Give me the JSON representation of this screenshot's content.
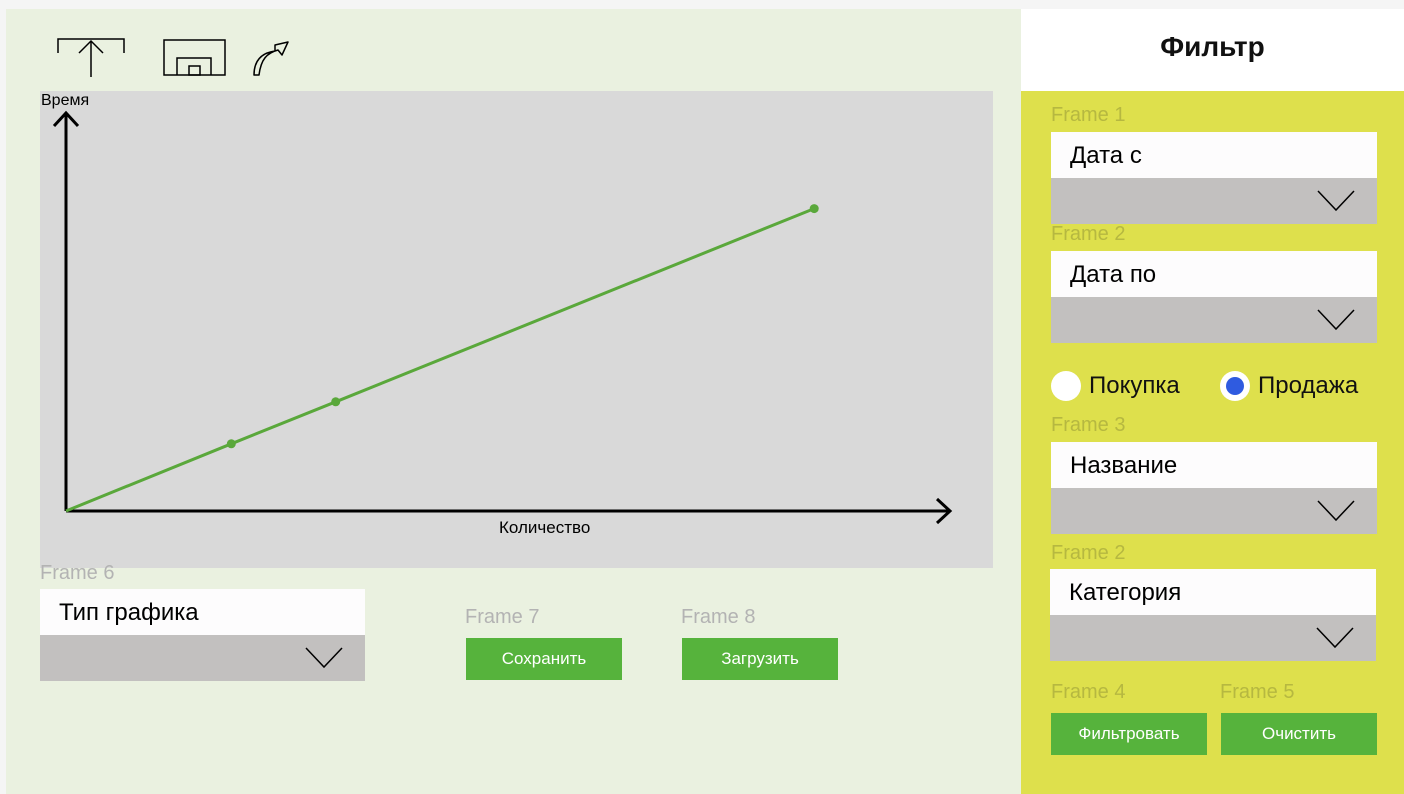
{
  "toolbar": {
    "icons": [
      "export-icon",
      "frame-window-icon",
      "share-arrow-icon"
    ]
  },
  "chart_data": {
    "type": "line",
    "title": "",
    "xlabel": "Количество",
    "ylabel": "Время",
    "grid": false,
    "series": [
      {
        "color": "#5aa83b",
        "x": [
          0,
          1.9,
          3.1,
          8.6
        ],
        "y": [
          0,
          1.6,
          2.6,
          7.2
        ]
      }
    ],
    "xlim": [
      0,
      10
    ],
    "ylim": [
      0,
      10
    ]
  },
  "chart_type": {
    "frame_label": "Frame 6",
    "label": "Тип графика"
  },
  "actions": {
    "save": {
      "frame_label": "Frame 7",
      "label": "Сохранить"
    },
    "load": {
      "frame_label": "Frame 8",
      "label": "Загрузить"
    }
  },
  "sidebar": {
    "title": "Фильтр",
    "date_from": {
      "frame_label": "Frame 1",
      "label": "Дата с"
    },
    "date_to": {
      "frame_label": "Frame 2",
      "label": "Дата по"
    },
    "operation": {
      "options": [
        {
          "label": "Покупка",
          "checked": false
        },
        {
          "label": "Продажа",
          "checked": true
        }
      ]
    },
    "name": {
      "frame_label": "Frame 3",
      "label": "Название"
    },
    "category": {
      "frame_label": "Frame 2",
      "label": "Категория"
    },
    "filter_btn": {
      "frame_label": "Frame 4",
      "label": "Фильтровать"
    },
    "clear_btn": {
      "frame_label": "Frame 5",
      "label": "Очистить"
    }
  },
  "colors": {
    "main_bg": "#eaf1e0",
    "chart_bg": "#d9d9d9",
    "sidebar_bg": "#dee04c",
    "button": "#56b33c",
    "radio_checked": "#2f5be0"
  }
}
